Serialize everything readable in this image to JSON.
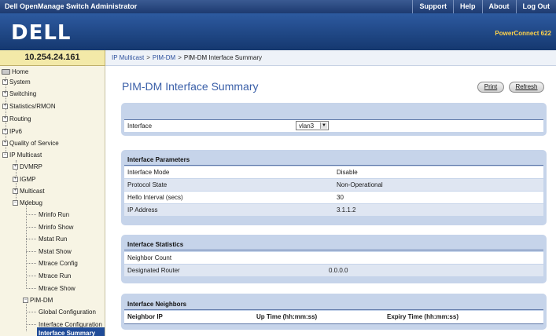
{
  "header": {
    "app_title": "Dell OpenManage Switch Administrator",
    "links": [
      "Support",
      "Help",
      "About",
      "Log Out"
    ],
    "logo": "DELL",
    "model": "PowerConnect 622"
  },
  "address": "10.254.24.161",
  "breadcrumb": [
    "IP Multicast",
    "PIM-DM",
    "PIM-DM Interface Summary"
  ],
  "nav": {
    "home": "Home",
    "system": "System",
    "switching": "Switching",
    "statistics": "Statistics/RMON",
    "routing": "Routing",
    "ipv6": "IPv6",
    "qos": "Quality of Service",
    "ip_multicast": "IP Multicast",
    "dvmrp": "DVMRP",
    "igmp": "IGMP",
    "multicast": "Multicast",
    "mdebug": "Mdebug",
    "mrinfo_run": "Mrinfo Run",
    "mrinfo_show": "Mrinfo Show",
    "mstat_run": "Mstat Run",
    "mstat_show": "Mstat Show",
    "mtrace_config": "Mtrace Config",
    "mtrace_run": "Mtrace Run",
    "mtrace_show": "Mtrace Show",
    "pimdm": "PIM-DM",
    "global_config": "Global Configuration",
    "interface_config": "Interface Configuration",
    "interface_summary": "Interface Summary"
  },
  "main": {
    "title": "PIM-DM Interface Summary",
    "print_label": "Print",
    "refresh_label": "Refresh",
    "interface_label": "Interface",
    "interface_value": "vlan3",
    "params": {
      "heading": "Interface Parameters",
      "rows": [
        {
          "label": "Interface Mode",
          "value": "Disable"
        },
        {
          "label": "Protocol State",
          "value": "Non-Operational"
        },
        {
          "label": "Hello Interval (secs)",
          "value": "30"
        },
        {
          "label": "IP Address",
          "value": "3.1.1.2"
        }
      ]
    },
    "stats": {
      "heading": "Interface Statistics",
      "rows": [
        {
          "label": "Neighbor Count",
          "value": ""
        },
        {
          "label": "Designated Router",
          "value": "0.0.0.0"
        }
      ]
    },
    "neighbors": {
      "heading": "Interface Neighbors",
      "columns": [
        "Neighbor IP",
        "Up Time (hh:mm:ss)",
        "Expiry Time (hh:mm:ss)"
      ]
    }
  }
}
